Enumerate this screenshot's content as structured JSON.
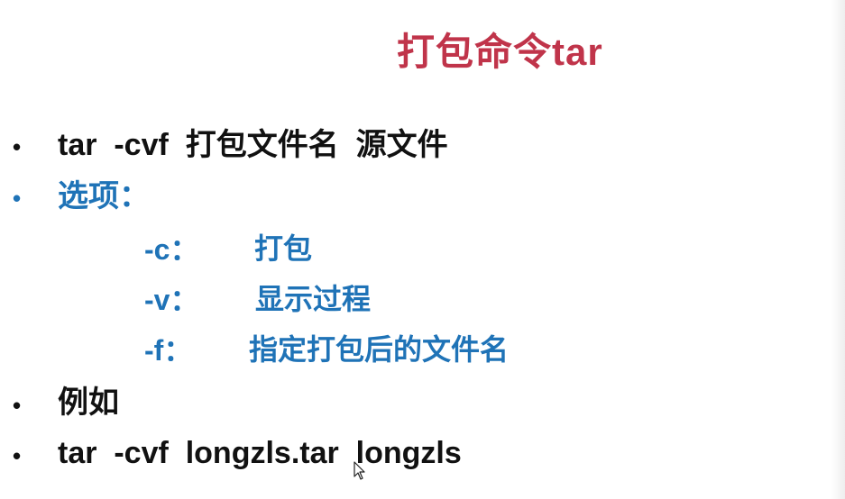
{
  "title": "打包命令tar",
  "bullet_symbol": "•",
  "lines": {
    "syntax": "tar  -cvf  打包文件名  源文件",
    "options_label": "选项：",
    "example_label": "例如",
    "example_cmd": "tar  -cvf  longzls.tar  longzls"
  },
  "options": [
    {
      "flag": "-c：",
      "desc": "打包"
    },
    {
      "flag": "-v：",
      "desc": "显示过程"
    },
    {
      "flag": "-f：",
      "desc": "指定打包后的文件名"
    }
  ],
  "colors": {
    "title": "#c0344a",
    "text": "#111111",
    "accent": "#1f73b7"
  },
  "cursor_icon": "mouse-pointer-icon"
}
